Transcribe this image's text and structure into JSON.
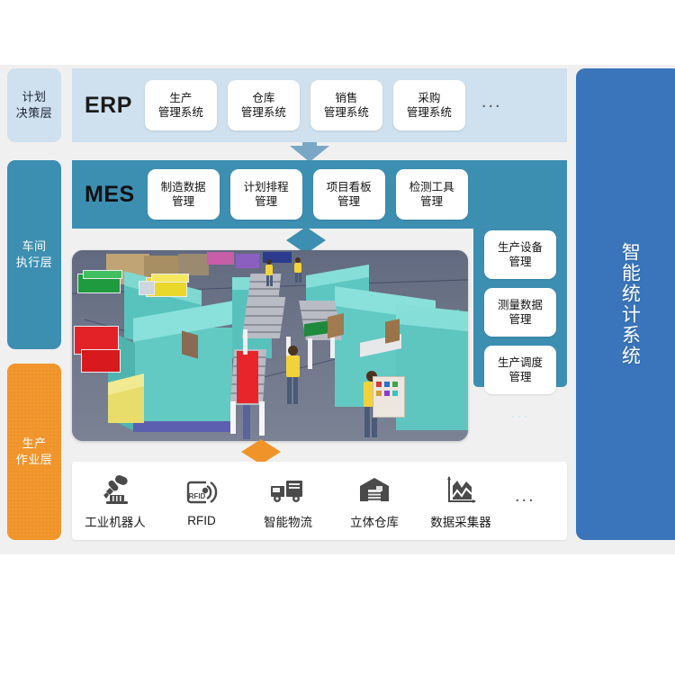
{
  "layers": [
    {
      "id": "plan",
      "label": "计划\n决策层",
      "line1": "计划",
      "line2": "决策层",
      "color": "#cfe0ee"
    },
    {
      "id": "shop",
      "label": "车间\n执行层",
      "line1": "车间",
      "line2": "执行层",
      "color": "#3d8fb2"
    },
    {
      "id": "prod",
      "label": "生产\n作业层",
      "line1": "生产",
      "line2": "作业层",
      "color": "#f0942a"
    }
  ],
  "erp": {
    "title": "ERP",
    "band_color": "#cfe0ee",
    "modules": [
      {
        "line1": "生产",
        "line2": "管理系统"
      },
      {
        "line1": "仓库",
        "line2": "管理系统"
      },
      {
        "line1": "销售",
        "line2": "管理系统"
      },
      {
        "line1": "采购",
        "line2": "管理系统"
      }
    ],
    "more": "..."
  },
  "mes": {
    "title": "MES",
    "band_color": "#3d8fb2",
    "modules": [
      {
        "line1": "制造数据",
        "line2": "管理"
      },
      {
        "line1": "计划排程",
        "line2": "管理"
      },
      {
        "line1": "项目看板",
        "line2": "管理"
      },
      {
        "line1": "检测工具",
        "line2": "管理"
      },
      {
        "line1": "生产设备",
        "line2": "管理"
      }
    ],
    "side_modules": [
      {
        "line1": "测量数据",
        "line2": "管理"
      },
      {
        "line1": "生产调度",
        "line2": "管理"
      }
    ],
    "more": "..."
  },
  "scene": {
    "name": "3d-factory-workshop-rendering",
    "description": "三维车间生产线效果图"
  },
  "arrows": {
    "erp_mes_color": "#6f9fc0",
    "mes_scene_color": "#3d8fb2",
    "scene_devices_color": "#f0942a"
  },
  "devices": {
    "panel_color": "#ffffff",
    "items": [
      {
        "icon": "robot-arm-icon",
        "label": "工业机器人"
      },
      {
        "icon": "rfid-tag-icon",
        "label": "RFID"
      },
      {
        "icon": "delivery-truck-icon",
        "label": "智能物流"
      },
      {
        "icon": "warehouse-icon",
        "label": "立体仓库"
      },
      {
        "icon": "chart-data-icon",
        "label": "数据采集器"
      }
    ],
    "more": "..."
  },
  "right_panel": {
    "label": "智能统计系统",
    "color": "#3a75bb"
  }
}
